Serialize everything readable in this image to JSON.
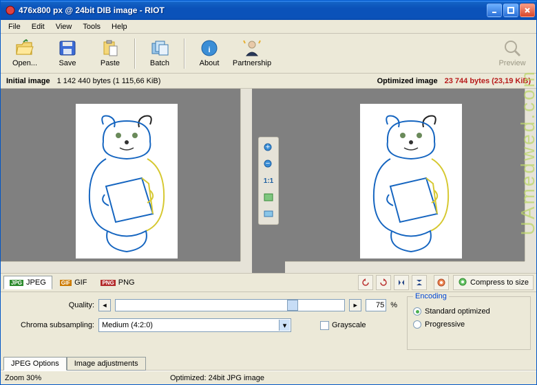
{
  "title": "476x800 px @ 24bit  DIB image - RIOT",
  "menu": {
    "file": "File",
    "edit": "Edit",
    "view": "View",
    "tools": "Tools",
    "help": "Help"
  },
  "toolbar": {
    "open": "Open...",
    "save": "Save",
    "paste": "Paste",
    "batch": "Batch",
    "about": "About",
    "partnership": "Partnership",
    "preview": "Preview"
  },
  "info": {
    "initial_label": "Initial image",
    "initial_val": "1 142 440 bytes (1 115,66 KiB)",
    "opt_label": "Optimized image",
    "opt_val": "23 744 bytes (23,19 KiB)"
  },
  "center": {
    "zoom11": "1:1"
  },
  "fmt": {
    "jpeg": "JPEG",
    "gif": "GIF",
    "png": "PNG",
    "compress": "Compress to size"
  },
  "opts": {
    "quality_label": "Quality:",
    "quality_value": "75",
    "pct": "%",
    "chroma_label": "Chroma subsampling:",
    "chroma_value": "Medium (4:2:0)",
    "grayscale": "Grayscale",
    "encoding": "Encoding",
    "standard": "Standard optimized",
    "progressive": "Progressive"
  },
  "bottabs": {
    "jpeg": "JPEG Options",
    "adj": "Image adjustments"
  },
  "status": {
    "zoom": "Zoom 30%",
    "opt": "Optimized: 24bit JPG image"
  },
  "watermark": "UAmedwed.com"
}
